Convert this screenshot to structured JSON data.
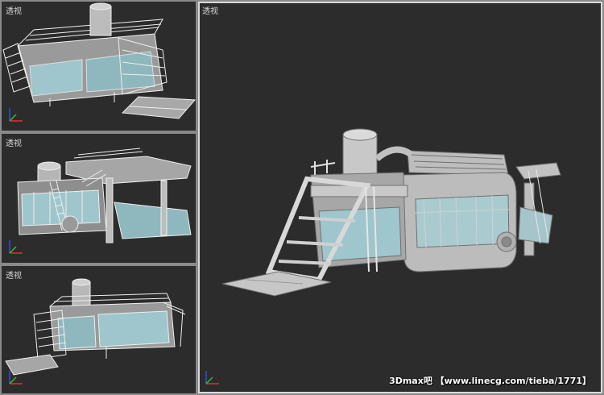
{
  "viewports": [
    {
      "id": "top-left",
      "label": "透视"
    },
    {
      "id": "middle-left",
      "label": "透视"
    },
    {
      "id": "bottom-left",
      "label": "透视"
    },
    {
      "id": "main",
      "label": "透视"
    }
  ],
  "watermark": "3Dmax吧 【www.linecg.com/tieba/1771】",
  "colors": {
    "viewport_bg": "#2c2c2c",
    "frame_bg": "#8a8a8a",
    "model_fill": "#c4c4c4",
    "model_shade": "#8e8e8e",
    "glass": "#9ec6cc",
    "wire": "#f0f0f0",
    "axis_x": "#e03030",
    "axis_y": "#30c030",
    "axis_z": "#3050e0"
  }
}
